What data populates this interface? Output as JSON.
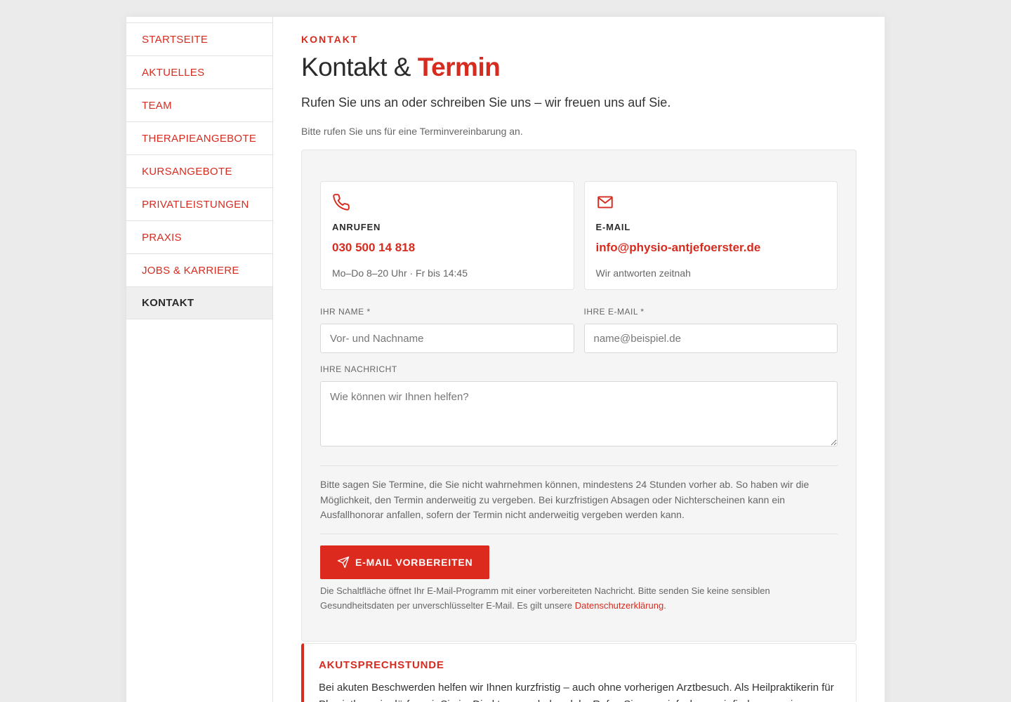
{
  "nav": {
    "items": [
      {
        "label": "STARTSEITE"
      },
      {
        "label": "AKTUELLES"
      },
      {
        "label": "TEAM"
      },
      {
        "label": "THERAPIEANGEBOTE"
      },
      {
        "label": "KURSANGEBOTE"
      },
      {
        "label": "PRIVATLEISTUNGEN"
      },
      {
        "label": "PRAXIS"
      },
      {
        "label": "JOBS & KARRIERE"
      },
      {
        "label": "KONTAKT"
      }
    ],
    "active": "KONTAKT"
  },
  "header": {
    "eyebrow": "KONTAKT",
    "title_main": "Kontakt & ",
    "title_accent": "Termin",
    "lead": "Rufen Sie uns an oder schreiben Sie uns – wir freuen uns auf Sie.",
    "note": "Bitte rufen Sie uns für eine Terminvereinbarung an."
  },
  "cards": {
    "phone": {
      "icon": "phone-icon",
      "label": "ANRUFEN",
      "value": "030 500 14 818",
      "sub": "Mo–Do 8–20 Uhr · Fr bis 14:45"
    },
    "email": {
      "icon": "mail-icon",
      "label": "E-MAIL",
      "value": "info@physio-antjefoerster.de",
      "sub": "Wir antworten zeitnah"
    }
  },
  "form": {
    "name_label": "IHR NAME *",
    "name_placeholder": "Vor- und Nachname",
    "email_label": "IHRE E-MAIL *",
    "email_placeholder": "name@beispiel.de",
    "message_label": "IHRE NACHRICHT",
    "message_placeholder": "Wie können wir Ihnen helfen?",
    "policy": "Bitte sagen Sie Termine, die Sie nicht wahrnehmen können, mindestens 24 Stunden vorher ab. So haben wir die Möglichkeit, den Termin anderweitig zu vergeben. Bei kurzfristigen Absagen oder Nichterscheinen kann ein Ausfallhonorar anfallen, sofern der Termin nicht anderweitig vergeben werden kann.",
    "submit_label": "E-MAIL VORBEREITEN",
    "submit_icon": "send-icon",
    "submit_note": "Die Schaltfläche öffnet Ihr E-Mail-Programm mit einer vorbereiteten Nachricht. Bitte senden Sie keine sensiblen Gesundheitsdaten per unverschlüsselter E-Mail. Es gilt unsere ",
    "privacy_link": "Datenschutzerklärung",
    "submit_note_end": "."
  },
  "akut": {
    "title": "AKUTSPRECHSTUNDE",
    "text": "Bei akuten Beschwerden helfen wir Ihnen kurzfristig – auch ohne vorherigen Arztbesuch. Als Heilpraktikerin für Physiotherapie dürfen wir Sie im Direktzugang behandeln. Rufen Sie uns einfach an, wir finden gemeinsam"
  },
  "colors": {
    "accent": "#d62b1f",
    "button": "#dd2a1e",
    "panel_bg": "#f5f5f5",
    "page_bg": "#ebebeb"
  }
}
